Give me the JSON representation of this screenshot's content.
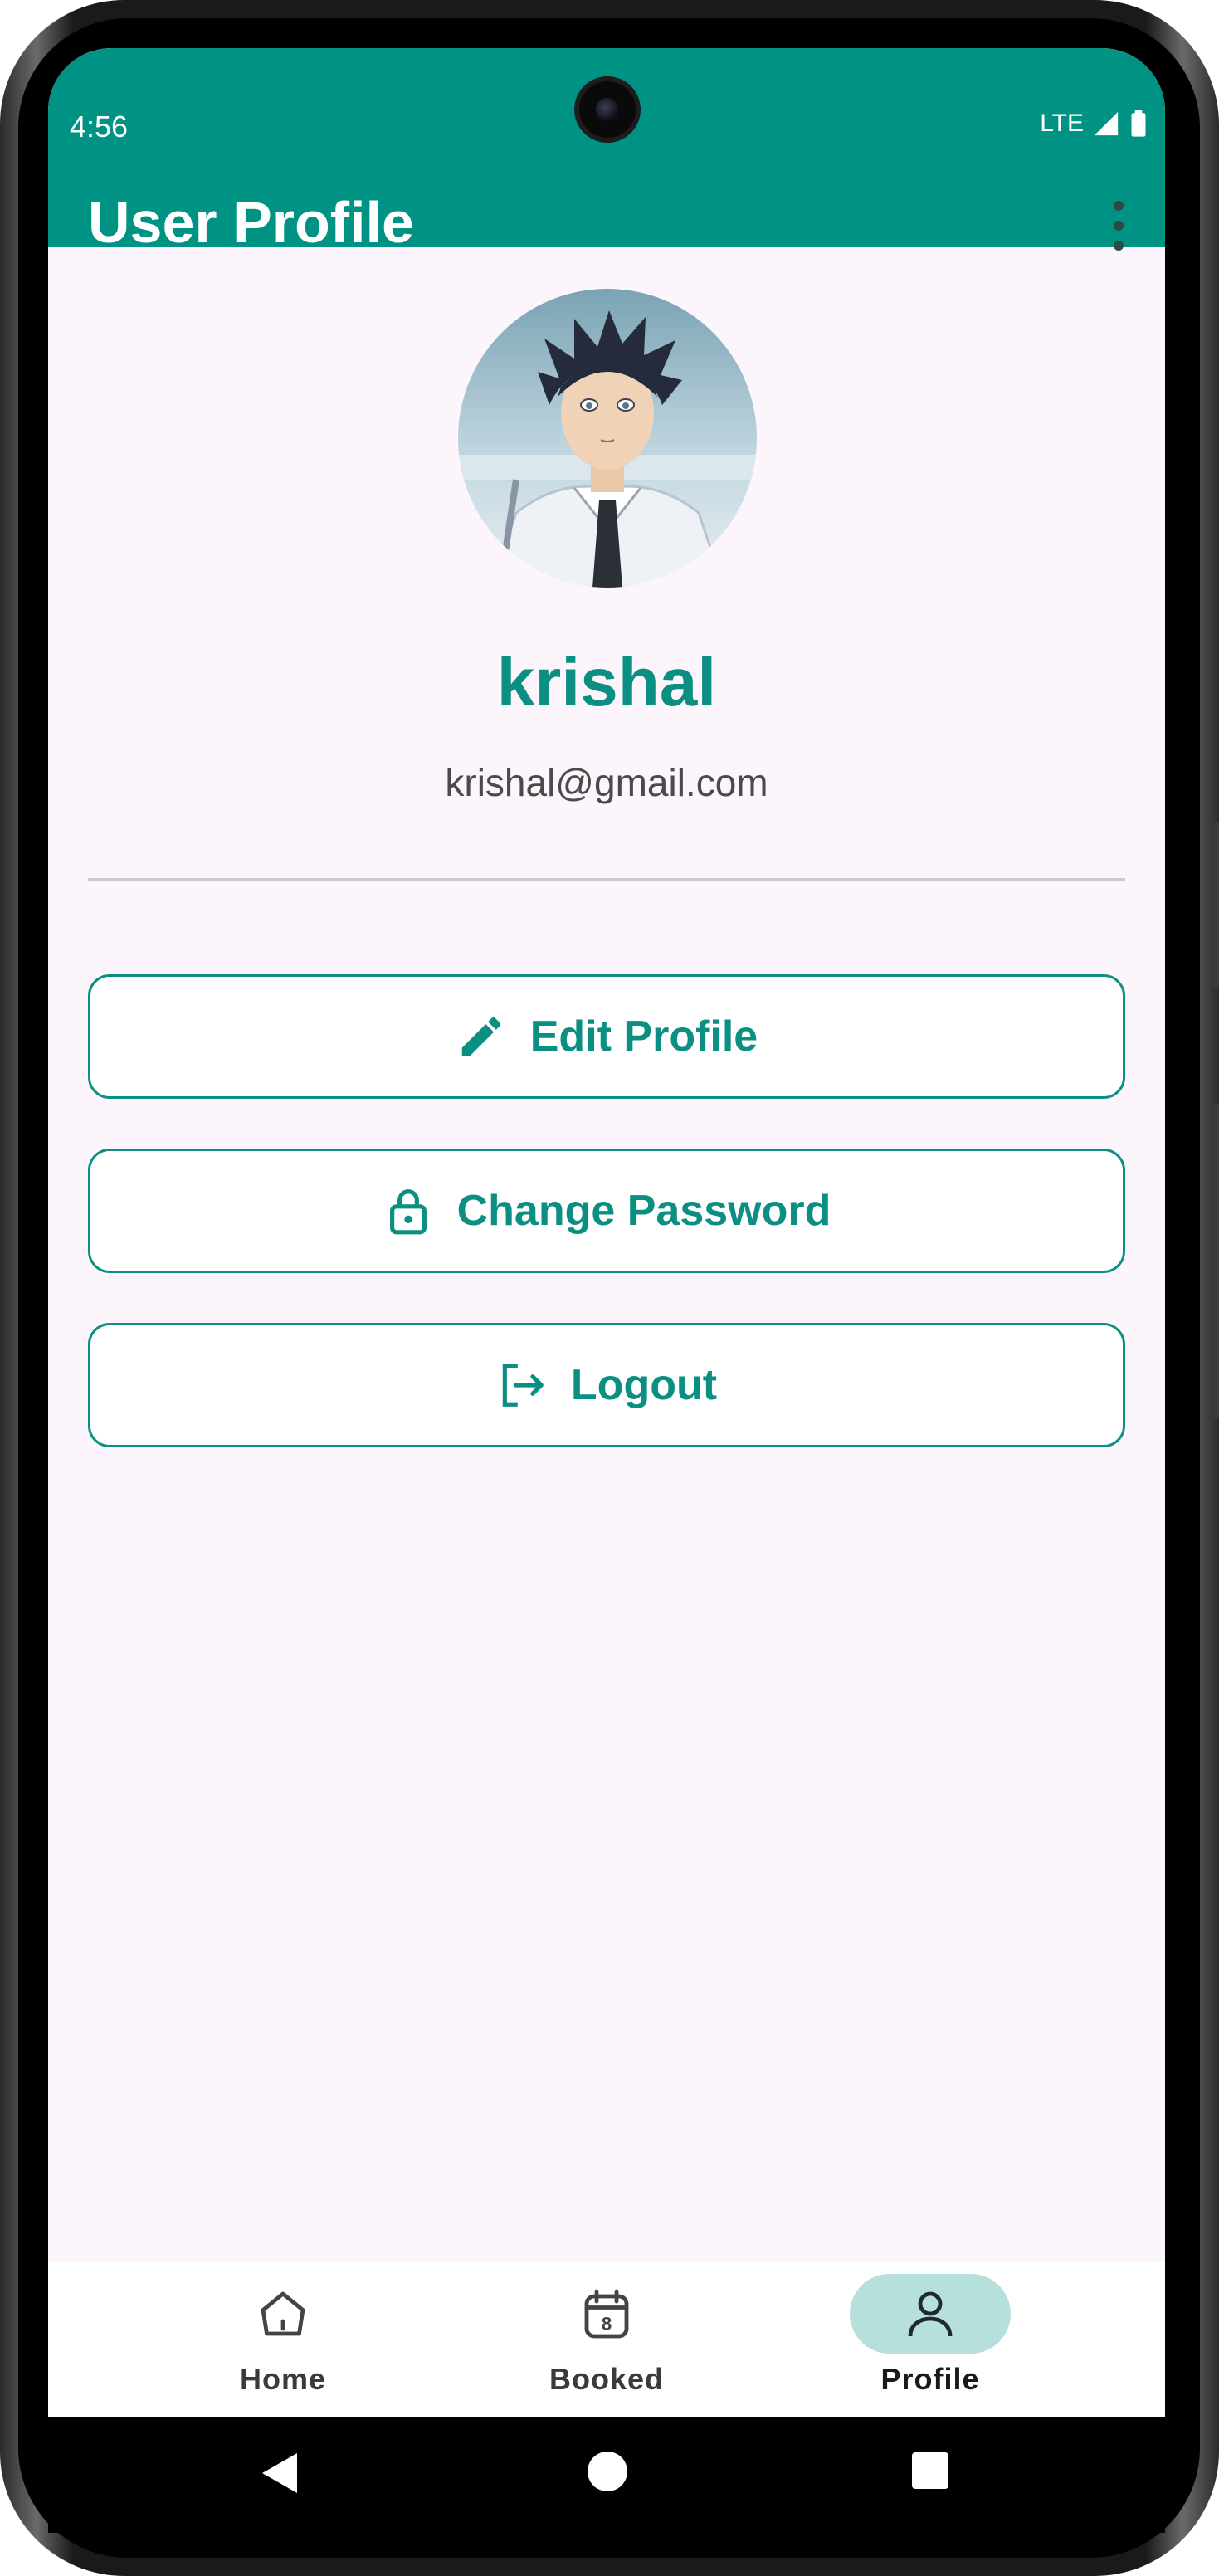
{
  "status_bar": {
    "time": "4:56",
    "network": "LTE"
  },
  "app_bar": {
    "title": "User Profile",
    "menu_icon": "more-vert-icon"
  },
  "profile": {
    "avatar_icon": "user-avatar-image",
    "name": "krishal",
    "email": "krishal@gmail.com"
  },
  "actions": [
    {
      "label": "Edit Profile",
      "icon": "edit-icon"
    },
    {
      "label": "Change Password",
      "icon": "lock-icon"
    },
    {
      "label": "Logout",
      "icon": "logout-icon"
    }
  ],
  "bottom_nav": [
    {
      "label": "Home",
      "icon": "home-icon",
      "active": false
    },
    {
      "label": "Booked",
      "icon": "calendar-icon",
      "active": false,
      "badge": "8"
    },
    {
      "label": "Profile",
      "icon": "person-icon",
      "active": true
    }
  ],
  "colors": {
    "primary": "#009384",
    "accent": "#0a8f82",
    "background": "#fdf5fc",
    "nav_active_pill": "#b6e0dc"
  }
}
